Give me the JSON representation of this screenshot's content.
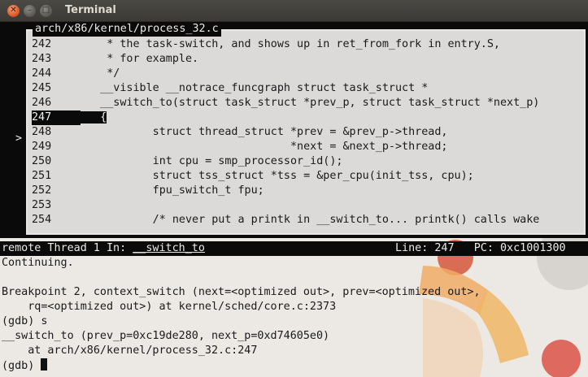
{
  "window": {
    "title": "Terminal",
    "close_glyph": "✕",
    "min_glyph": "–",
    "max_glyph": "□"
  },
  "source": {
    "path": "arch/x86/kernel/process_32.c",
    "current_marker": ">",
    "lines": [
      {
        "num": "242",
        "text": "    * the task-switch, and shows up in ret_from_fork in entry.S,",
        "current": false
      },
      {
        "num": "243",
        "text": "    * for example.",
        "current": false
      },
      {
        "num": "244",
        "text": "    */",
        "current": false
      },
      {
        "num": "245",
        "text": "   __visible __notrace_funcgraph struct task_struct *",
        "current": false
      },
      {
        "num": "246",
        "text": "   __switch_to(struct task_struct *prev_p, struct task_struct *next_p)",
        "current": false
      },
      {
        "num": "247",
        "text": "   {",
        "current": true
      },
      {
        "num": "248",
        "text": "           struct thread_struct *prev = &prev_p->thread,",
        "current": false
      },
      {
        "num": "249",
        "text": "                                *next = &next_p->thread;",
        "current": false
      },
      {
        "num": "250",
        "text": "           int cpu = smp_processor_id();",
        "current": false
      },
      {
        "num": "251",
        "text": "           struct tss_struct *tss = &per_cpu(init_tss, cpu);",
        "current": false
      },
      {
        "num": "252",
        "text": "           fpu_switch_t fpu;",
        "current": false
      },
      {
        "num": "253",
        "text": "",
        "current": false
      },
      {
        "num": "254",
        "text": "           /* never put a printk in __switch_to... printk() calls wake",
        "current": false
      }
    ]
  },
  "status": {
    "prefix": "remote Thread 1 In: ",
    "function": "__switch_to",
    "line_pc": "Line: 247   PC: 0xc1001300"
  },
  "console": {
    "lines": [
      "Continuing.",
      "",
      "Breakpoint 2, context_switch (next=<optimized out>, prev=<optimized out>,",
      "    rq=<optimized out>) at kernel/sched/core.c:2373",
      "(gdb) s",
      "__switch_to (prev_p=0xc19de280, next_p=0xd74605e0)",
      "    at arch/x86/kernel/process_32.c:247"
    ],
    "prompt": "(gdb) "
  },
  "colors": {
    "titlebar": "#3b3a36",
    "close_button": "#e25a25",
    "terminal_bg": "#0a0a0a",
    "source_bg": "#dcdad8",
    "console_bg": "#ece9e5"
  }
}
